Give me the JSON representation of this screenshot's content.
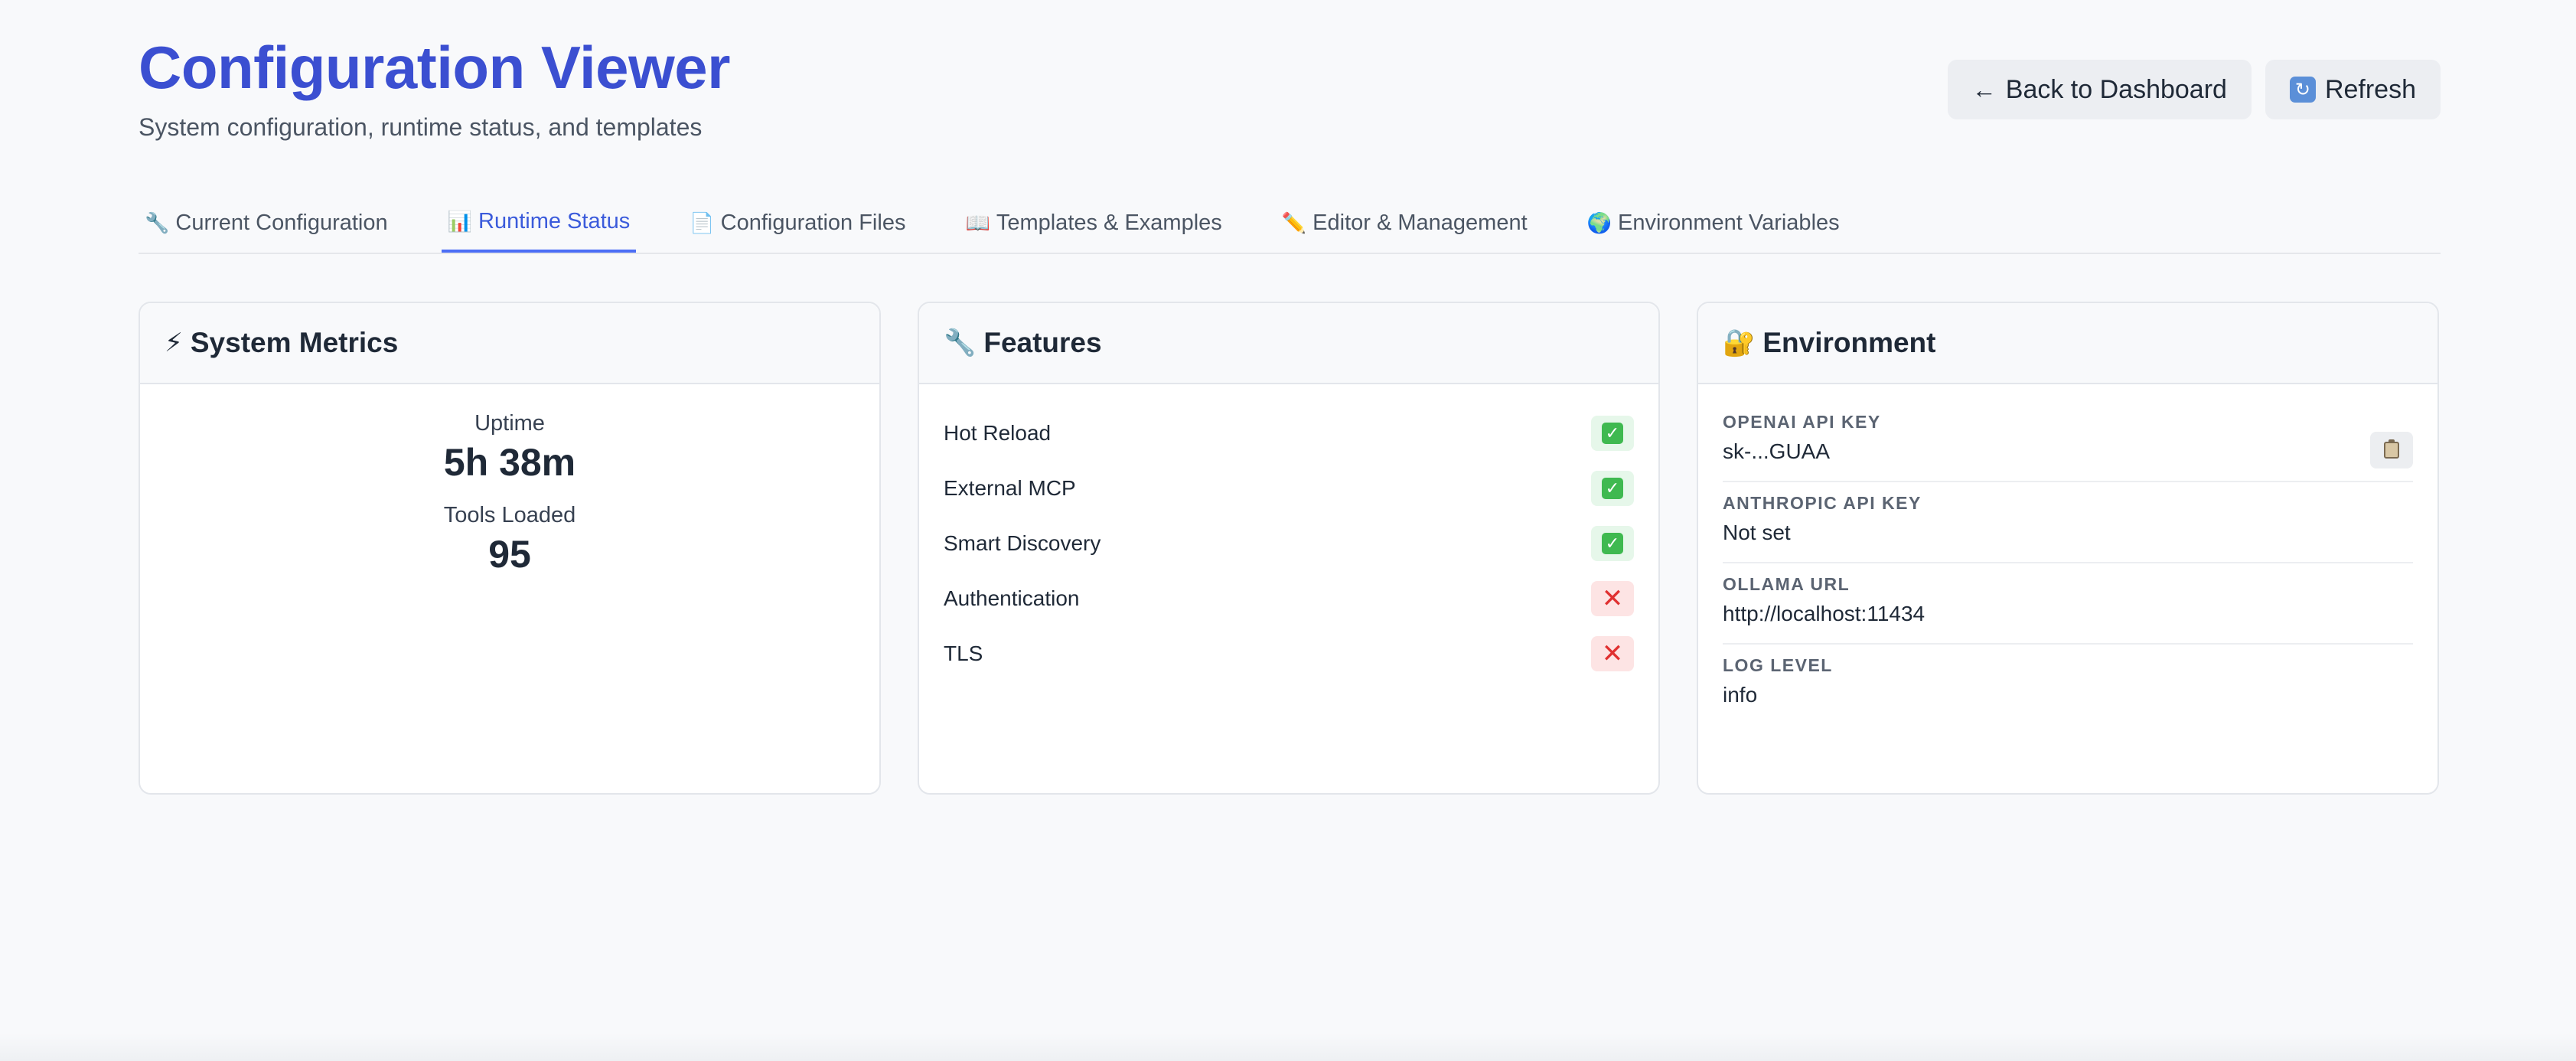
{
  "header": {
    "title": "Configuration Viewer",
    "subtitle": "System configuration, runtime status, and templates",
    "back_label": "Back to Dashboard",
    "back_icon": "←",
    "refresh_label": "Refresh",
    "refresh_icon": "🔄"
  },
  "tabs": [
    {
      "icon": "🔧",
      "label": "Current Configuration",
      "active": false
    },
    {
      "icon": "📊",
      "label": "Runtime Status",
      "active": true
    },
    {
      "icon": "📄",
      "label": "Configuration Files",
      "active": false
    },
    {
      "icon": "📖",
      "label": "Templates & Examples",
      "active": false
    },
    {
      "icon": "✏️",
      "label": "Editor & Management",
      "active": false
    },
    {
      "icon": "🌍",
      "label": "Environment Variables",
      "active": false
    }
  ],
  "metrics_card": {
    "icon": "⚡",
    "title": "System Metrics",
    "uptime_label": "Uptime",
    "uptime_value": "5h 38m",
    "tools_label": "Tools Loaded",
    "tools_value": "95"
  },
  "features_card": {
    "icon": "🔧",
    "title": "Features",
    "items": [
      {
        "name": "Hot Reload",
        "enabled": true,
        "mark": "✓"
      },
      {
        "name": "External MCP",
        "enabled": true,
        "mark": "✓"
      },
      {
        "name": "Smart Discovery",
        "enabled": true,
        "mark": "✓"
      },
      {
        "name": "Authentication",
        "enabled": false,
        "mark": "✕"
      },
      {
        "name": "TLS",
        "enabled": false,
        "mark": "✕"
      }
    ]
  },
  "environment_card": {
    "icon": "🔐",
    "title": "Environment",
    "items": [
      {
        "key": "OPENAI API KEY",
        "value": "sk-...GUAA",
        "copy": true
      },
      {
        "key": "ANTHROPIC API KEY",
        "value": "Not set",
        "copy": false
      },
      {
        "key": "OLLAMA URL",
        "value": "http://localhost:11434",
        "copy": false
      },
      {
        "key": "LOG LEVEL",
        "value": "info",
        "copy": false
      }
    ]
  },
  "colors": {
    "accent": "#3b4fd1",
    "active_tab": "#4c6ef5",
    "enabled_badge": "#e6f7ea",
    "disabled_badge": "#fde4e4"
  }
}
